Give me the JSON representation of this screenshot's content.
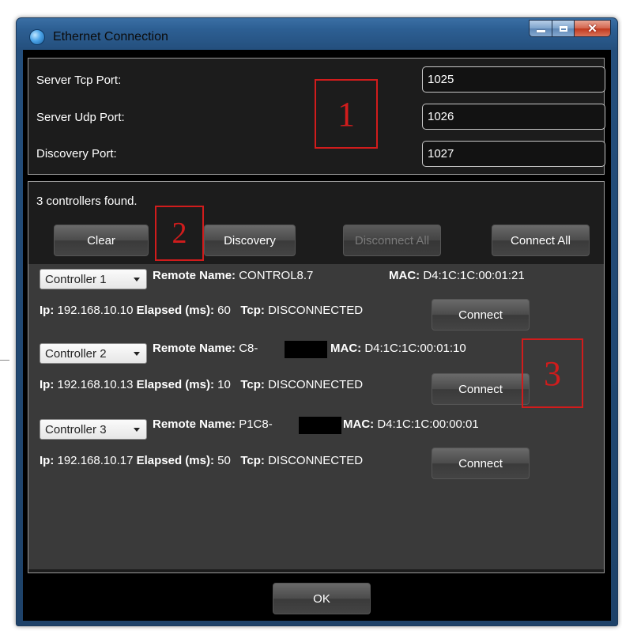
{
  "window": {
    "title": "Ethernet Connection",
    "icon": "app-globe-icon",
    "caption": {
      "minimize": "minimize-icon",
      "maximize": "maximize-icon",
      "close": "close-icon"
    }
  },
  "ports": {
    "tcp_label": "Server Tcp Port:",
    "tcp_value": "1025",
    "udp_label": "Server Udp Port:",
    "udp_value": "1026",
    "discovery_label": "Discovery Port:",
    "discovery_value": "1027"
  },
  "status": "3 controllers found.",
  "toolbar": {
    "clear": "Clear",
    "discovery": "Discovery",
    "disconnect_all": "Disconnect All",
    "connect_all": "Connect All"
  },
  "labels": {
    "remote_name": "Remote Name:",
    "mac": "MAC:",
    "ip": "Ip:",
    "elapsed": "Elapsed (ms):",
    "tcp": "Tcp:"
  },
  "controllers": [
    {
      "selector": "Controller 1",
      "remote_name": "CONTROL8.7",
      "mac": "D4:1C:1C:00:01:21",
      "ip": "192.168.10.10",
      "elapsed": "60",
      "tcp": "DISCONNECTED",
      "connect": "Connect"
    },
    {
      "selector": "Controller 2",
      "remote_name": "C8-",
      "mac": "D4:1C:1C:00:01:10",
      "ip": "192.168.10.13",
      "elapsed": "10",
      "tcp": "DISCONNECTED",
      "connect": "Connect"
    },
    {
      "selector": "Controller 3",
      "remote_name": "P1C8-",
      "mac": "D4:1C:1C:00:00:01",
      "ip": "192.168.10.17",
      "elapsed": "50",
      "tcp": "DISCONNECTED",
      "connect": "Connect"
    }
  ],
  "footer": {
    "ok": "OK"
  },
  "annotations": [
    "1",
    "2",
    "3"
  ],
  "colors": {
    "annotation": "#d11c1c",
    "panel_bg": "#1c1c1c",
    "list_bg": "#3a3a3a"
  }
}
